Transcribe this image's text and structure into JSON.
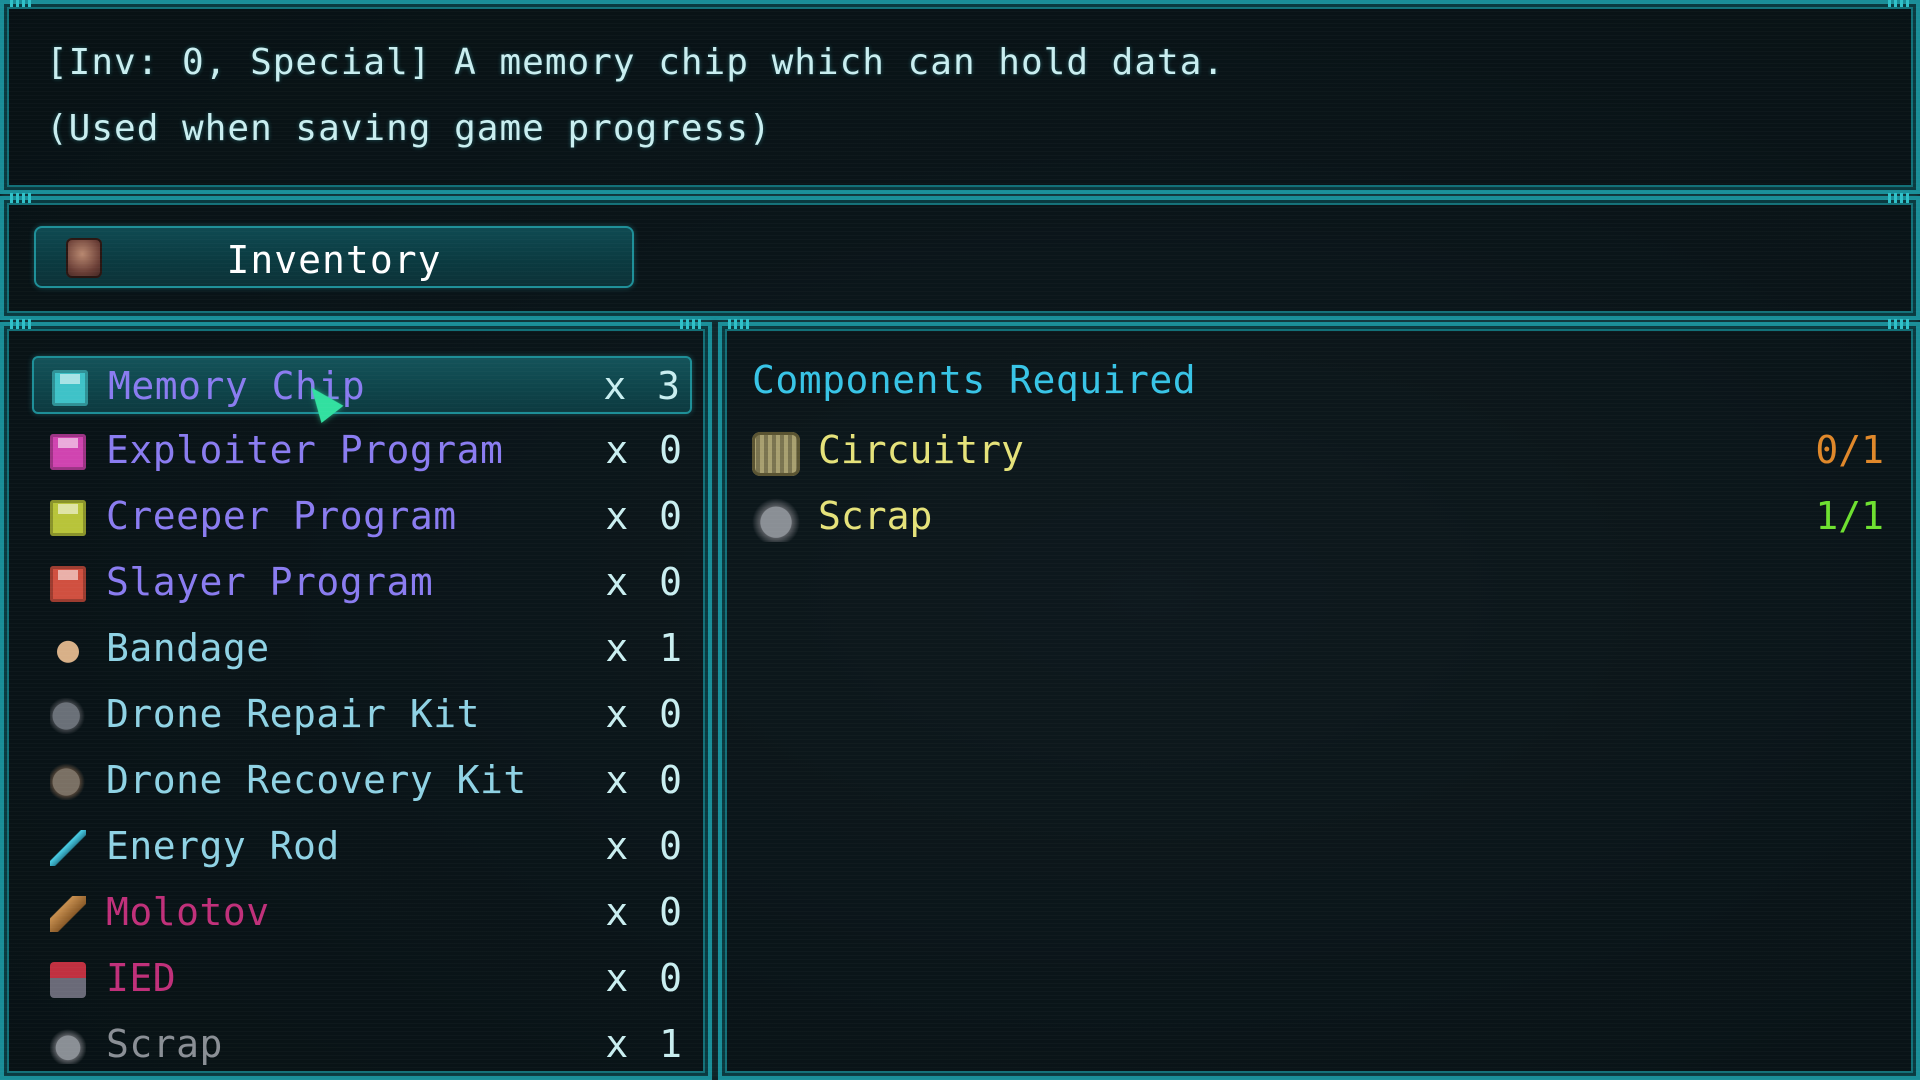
{
  "description": {
    "line1": "[Inv: 0, Special] A memory chip which can hold data.",
    "line2": "(Used when saving game progress)"
  },
  "tab": {
    "label": "Inventory",
    "icon": "backpack-icon"
  },
  "inventory": [
    {
      "name": "Memory Chip",
      "count": "x 3",
      "color": "#8a7cf0",
      "icon": "floppy-cyan-icon",
      "selected": true
    },
    {
      "name": "Exploiter Program",
      "count": "x 0",
      "color": "#8a7cf0",
      "icon": "floppy-magenta-icon"
    },
    {
      "name": "Creeper Program",
      "count": "x 0",
      "color": "#8a7cf0",
      "icon": "floppy-yellow-icon"
    },
    {
      "name": "Slayer Program",
      "count": "x 0",
      "color": "#8a7cf0",
      "icon": "floppy-red-icon"
    },
    {
      "name": "Bandage",
      "count": "x 1",
      "color": "#8fd2e4",
      "icon": "bandage-icon"
    },
    {
      "name": "Drone Repair Kit",
      "count": "x 0",
      "color": "#8fd2e4",
      "icon": "drone-repair-kit-icon"
    },
    {
      "name": "Drone Recovery Kit",
      "count": "x 0",
      "color": "#8fd2e4",
      "icon": "drone-recovery-kit-icon"
    },
    {
      "name": "Energy Rod",
      "count": "x 0",
      "color": "#8fd2e4",
      "icon": "energy-rod-icon"
    },
    {
      "name": "Molotov",
      "count": "x 0",
      "color": "#c0307a",
      "icon": "molotov-icon"
    },
    {
      "name": "IED",
      "count": "x 0",
      "color": "#c0307a",
      "icon": "ied-icon"
    },
    {
      "name": "Scrap",
      "count": "x 1",
      "color": "#8a8f95",
      "icon": "scrap-icon"
    }
  ],
  "components": {
    "title": "Components Required",
    "items": [
      {
        "name": "Circuitry",
        "count": "0/1",
        "count_color": "#e0882a",
        "icon": "circuitry-icon"
      },
      {
        "name": "Scrap",
        "count": "1/1",
        "count_color": "#6ee030",
        "icon": "scrap-icon"
      }
    ]
  },
  "colors": {
    "frame": "#1a8e98",
    "description_text": "#c9eef0",
    "components_title": "#38c4e6",
    "component_name": "#e5e27a"
  }
}
